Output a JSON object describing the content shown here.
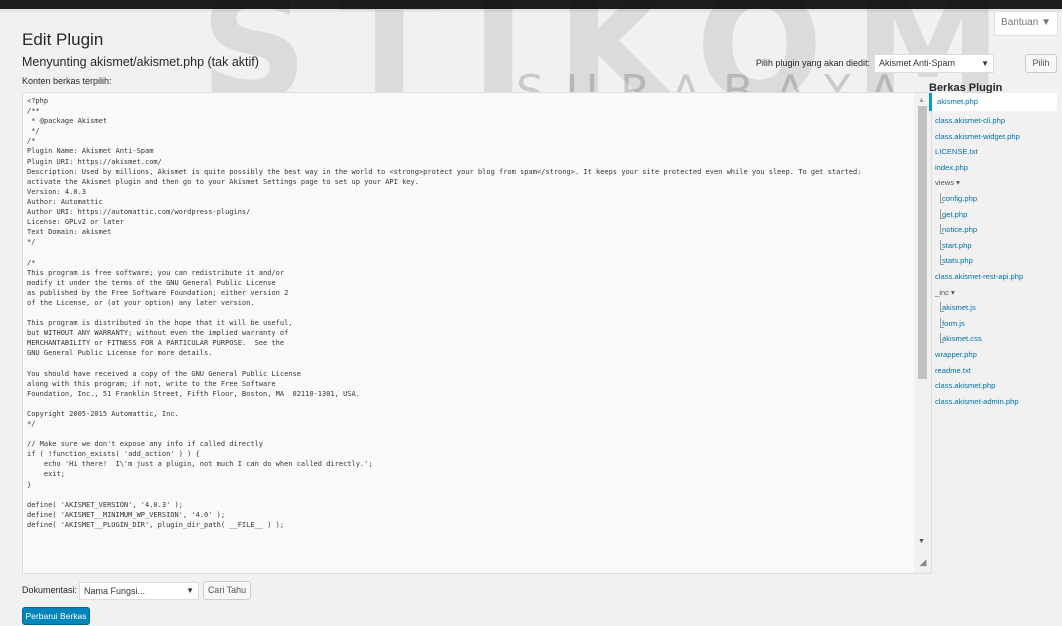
{
  "watermark": {
    "big": "STIKOM",
    "sub": "SURABAYA"
  },
  "help_button": "Bantuan ▼",
  "page_title": "Edit Plugin",
  "subtitle": "Menyunting akismet/akismet.php (tak aktif)",
  "plugin_select": {
    "label": "Pilih plugin yang akan diedit:",
    "value": "Akismet Anti-Spam",
    "button": "Pilih"
  },
  "content_label": "Konten berkas terpilih:",
  "code_text": "<?php\n/**\n * @package Akismet\n */\n/*\nPlugin Name: Akismet Anti-Spam\nPlugin URI: https://akismet.com/\nDescription: Used by millions, Akismet is quite possibly the best way in the world to <strong>protect your blog from spam</strong>. It keeps your site protected even while you sleep. To get started:\nactivate the Akismet plugin and then go to your Akismet Settings page to set up your API key.\nVersion: 4.0.3\nAuthor: Automattic\nAuthor URI: https://automattic.com/wordpress-plugins/\nLicense: GPLv2 or later\nText Domain: akismet\n*/\n\n/*\nThis program is free software; you can redistribute it and/or\nmodify it under the terms of the GNU General Public License\nas published by the Free Software Foundation; either version 2\nof the License, or (at your option) any later version.\n\nThis program is distributed in the hope that it will be useful,\nbut WITHOUT ANY WARRANTY; without even the implied warranty of\nMERCHANTABILITY or FITNESS FOR A PARTICULAR PURPOSE.  See the\nGNU General Public License for more details.\n\nYou should have received a copy of the GNU General Public License\nalong with this program; if not, write to the Free Software\nFoundation, Inc., 51 Franklin Street, Fifth Floor, Boston, MA  02110-1301, USA.\n\nCopyright 2005-2015 Automattic, Inc.\n*/\n\n// Make sure we don't expose any info if called directly\nif ( !function_exists( 'add_action' ) ) {\n    echo 'Hi there!  I\\'m just a plugin, not much I can do when called directly.';\n    exit;\n}\n\ndefine( 'AKISMET_VERSION', '4.0.3' );\ndefine( 'AKISMET__MINIMUM_WP_VERSION', '4.0' );\ndefine( 'AKISMET__PLUGIN_DIR', plugin_dir_path( __FILE__ ) );",
  "files_heading": "Berkas Plugin",
  "files": [
    {
      "label": "akismet.php",
      "kind": "active"
    },
    {
      "label": "class.akismet-cli.php",
      "kind": "file"
    },
    {
      "label": "class.akismet-widget.php",
      "kind": "file"
    },
    {
      "label": "LICENSE.txt",
      "kind": "file"
    },
    {
      "label": "index.php",
      "kind": "file"
    },
    {
      "label": "views ▾",
      "kind": "folder"
    },
    {
      "label": "config.php",
      "kind": "child"
    },
    {
      "label": "get.php",
      "kind": "child"
    },
    {
      "label": "notice.php",
      "kind": "child"
    },
    {
      "label": "start.php",
      "kind": "child"
    },
    {
      "label": "stats.php",
      "kind": "child"
    },
    {
      "label": "class.akismet-rest-api.php",
      "kind": "file"
    },
    {
      "label": "_inc ▾",
      "kind": "folder"
    },
    {
      "label": "akismet.js",
      "kind": "child"
    },
    {
      "label": "form.js",
      "kind": "child"
    },
    {
      "label": "akismet.css",
      "kind": "child"
    },
    {
      "label": "wrapper.php",
      "kind": "file"
    },
    {
      "label": "readme.txt",
      "kind": "file"
    },
    {
      "label": "class.akismet.php",
      "kind": "file"
    },
    {
      "label": "class.akismet-admin.php",
      "kind": "file"
    }
  ],
  "documentation": {
    "label": "Dokumentasi:",
    "select_value": "Nama Fungsi...",
    "button": "Cari Tahu"
  },
  "update_button": "Perbarui Berkas",
  "icons": {
    "caret": "▼",
    "scroll_up": "▲",
    "scroll_down": "▼",
    "resize": "◢"
  },
  "colors": {
    "primary": "#0085ba",
    "link": "#0073aa",
    "active_border": "#00a0d2"
  }
}
